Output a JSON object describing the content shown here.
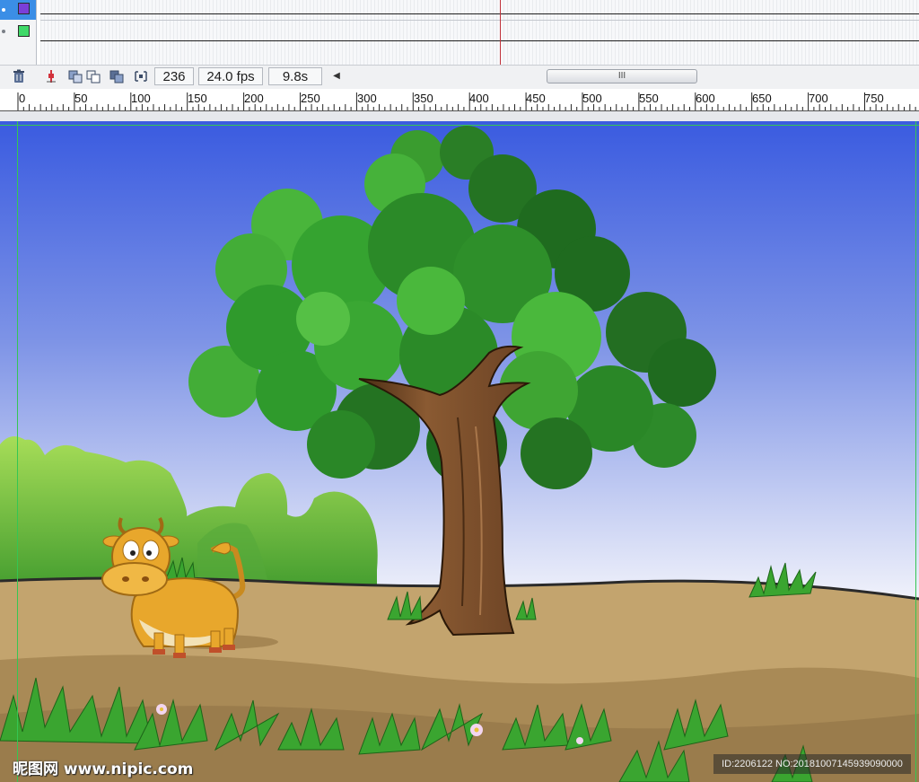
{
  "layers": [
    {
      "name": "layer-purple",
      "color": "#7a3fd9",
      "selected": true
    },
    {
      "name": "layer-green",
      "color": "#3fd968",
      "selected": false
    }
  ],
  "toolbar": {
    "icons": [
      "trash-icon",
      "center-frame-icon",
      "onion-skin-icon",
      "onion-skin-outline-icon",
      "edit-multiple-frames-icon",
      "modify-onion-markers-icon"
    ],
    "current_frame": "236",
    "frame_rate": "24.0 fps",
    "elapsed_time": "9.8s",
    "scroll_grip": "III"
  },
  "ruler": {
    "labels": [
      "0",
      "50",
      "100",
      "150",
      "200",
      "250",
      "300",
      "350",
      "400",
      "450",
      "500",
      "550",
      "600",
      "650",
      "700",
      "750"
    ]
  },
  "stage": {
    "scene": "cartoon cow beside tree in grassy field",
    "sky_top": "#3a5be0",
    "sky_bottom": "#f3f4fb",
    "ground": "#c3a46e",
    "foliage": "#2f9a2c",
    "trunk": "#7d4f2b",
    "cow": "#e8a72c",
    "guide_color": "#35c653"
  },
  "watermark": {
    "site": "昵图网 www.nipic.com",
    "id": "ID:2206122 NO:20181007145939090000"
  }
}
